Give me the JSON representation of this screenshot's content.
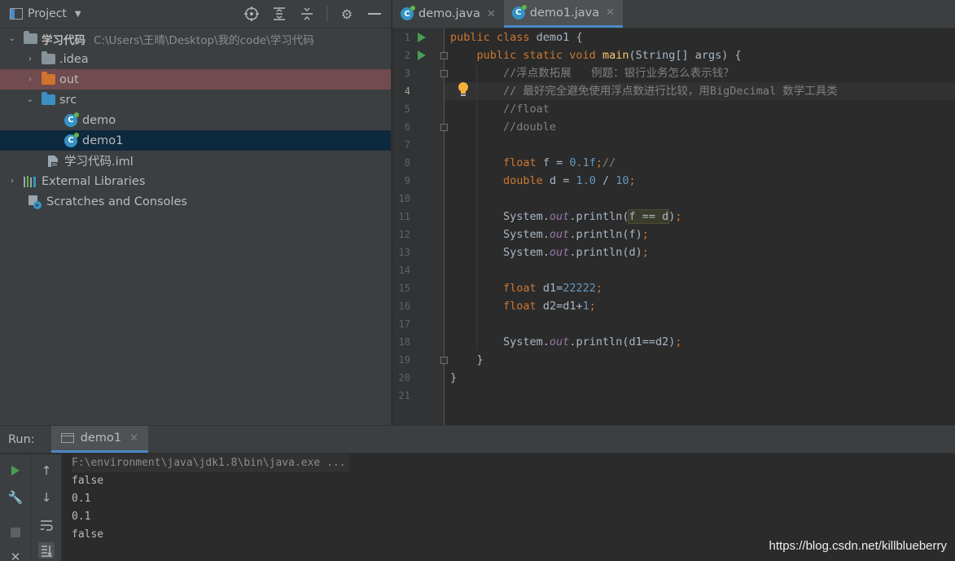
{
  "project_panel": {
    "title": "Project",
    "tree": [
      {
        "label": "学习代码",
        "path": "C:\\Users\\王晴\\Desktop\\我的code\\学习代码",
        "icon": "module-folder-icon",
        "expanded": true
      },
      {
        "label": ".idea",
        "icon": "folder-icon",
        "expanded": false
      },
      {
        "label": "out",
        "icon": "excluded-folder-icon",
        "expanded": false
      },
      {
        "label": "src",
        "icon": "source-folder-icon",
        "expanded": true
      },
      {
        "label": "demo",
        "icon": "java-class-icon"
      },
      {
        "label": "demo1",
        "icon": "java-class-icon"
      },
      {
        "label": "学习代码.iml",
        "icon": "iml-file-icon"
      },
      {
        "label": "External Libraries",
        "icon": "libraries-icon",
        "expanded": false
      },
      {
        "label": "Scratches and Consoles",
        "icon": "scratches-icon"
      }
    ]
  },
  "editor": {
    "tabs": [
      {
        "label": "demo.java",
        "active": false
      },
      {
        "label": "demo1.java",
        "active": true
      }
    ],
    "line_numbers": [
      "1",
      "2",
      "3",
      "4",
      "5",
      "6",
      "7",
      "8",
      "9",
      "10",
      "11",
      "12",
      "13",
      "14",
      "15",
      "16",
      "17",
      "18",
      "19",
      "20",
      "21"
    ],
    "current_line": 4
  },
  "run_panel": {
    "label": "Run:",
    "tab": "demo1",
    "output": [
      "F:\\environment\\java\\jdk1.8\\bin\\java.exe ...",
      "false",
      "0.1",
      "0.1",
      "false"
    ]
  },
  "watermark": "https://blog.csdn.net/killblueberry",
  "colors": {
    "keyword": "#cc7832",
    "function": "#ffc66d",
    "number": "#6897bb",
    "comment": "#808080",
    "field": "#9876aa",
    "selection": "#0d293e",
    "excluded": "#704b4f"
  }
}
